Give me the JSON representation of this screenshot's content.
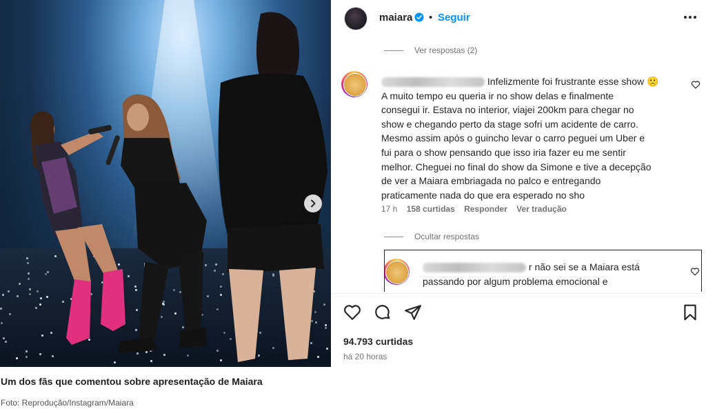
{
  "post": {
    "username": "maiara",
    "follow_label": "Seguir",
    "view_replies_label": "Ver respostas (2)",
    "hide_replies_label": "Ocultar respostas",
    "likes_label": "94.793 curtidas",
    "time_ago": "há 20 horas",
    "icons": [
      "verified-badge-icon",
      "more-options-icon",
      "chevron-right-icon",
      "heart-icon",
      "comment-icon",
      "share-icon",
      "bookmark-icon"
    ],
    "accent_color": "#0095f6"
  },
  "comment": {
    "lines": [
      "Infelizmente foi frustrante esse show",
      "A muito tempo eu queria ir no show delas e finalmente",
      "consegui ir. Estava no interior, viajei 200km para chegar no",
      "show e chegando perto da stage sofri um acidente de carro.",
      "Mesmo assim após o guincho levar o carro peguei um Uber e",
      "fui para o show pensando que isso iria fazer eu me sentir",
      "melhor. Cheguei no final do show da Simone e tive a decepção",
      "de ver a Maiara embriagada no palco e entregando",
      "praticamente nada do que era esperado no sho"
    ],
    "emoji": "🙁",
    "time": "17 h",
    "likes": "158 curtidas",
    "reply_label": "Responder",
    "translate_label": "Ver tradução"
  },
  "reply": {
    "line1": "r não sei se a Maiara está",
    "line2": "passando por algum problema emocional e"
  },
  "article": {
    "caption": "Um dos fãs que comentou sobre apresentação de Maiara",
    "credit": "Foto: Reprodução/Instagram/Maiara"
  }
}
